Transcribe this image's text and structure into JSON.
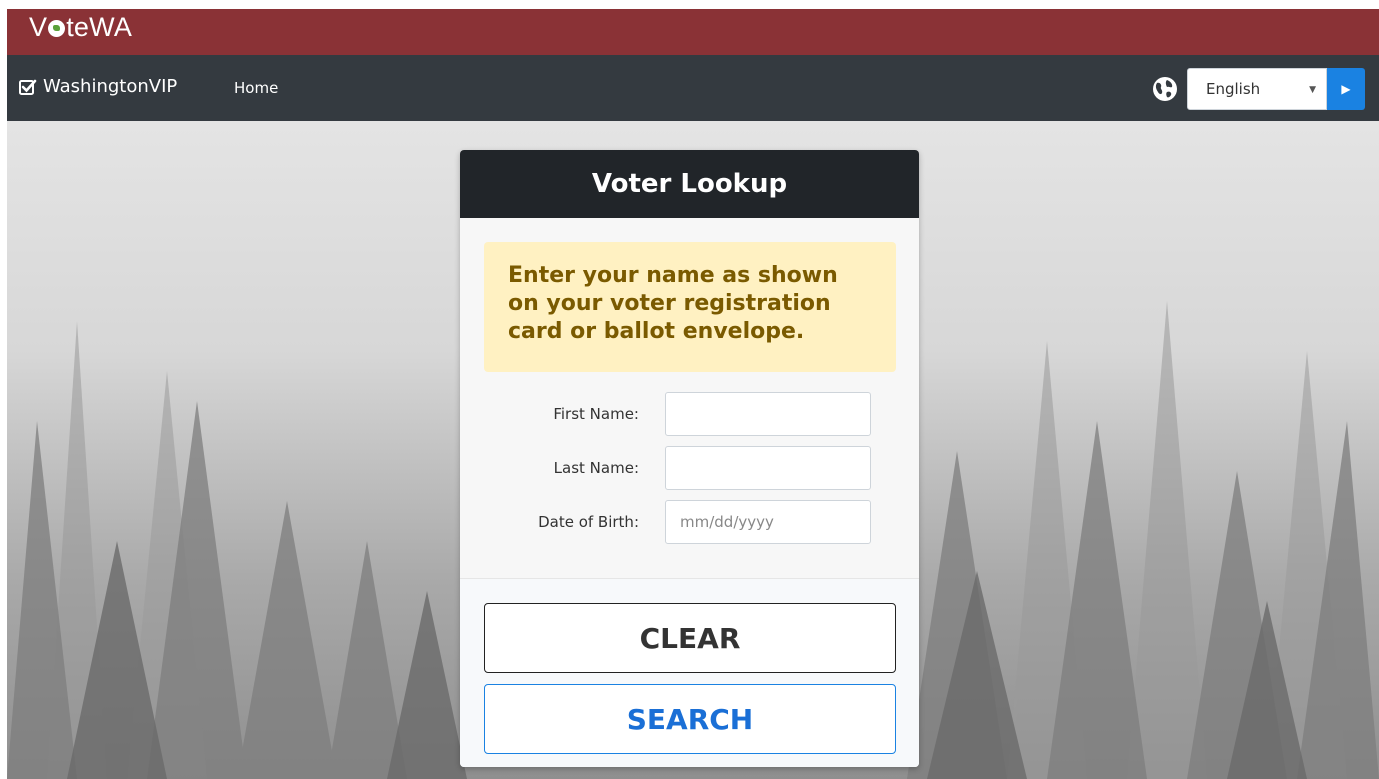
{
  "brand": {
    "prefix": "V",
    "suffix": "teWA"
  },
  "nav": {
    "brand_label": "WashingtonVIP",
    "home_label": "Home",
    "language_selected": "English"
  },
  "card": {
    "title": "Voter Lookup",
    "instructions": "Enter your name as shown on your voter registration card or ballot envelope.",
    "fields": {
      "first_name_label": "First Name:",
      "last_name_label": "Last Name:",
      "dob_label": "Date of Birth:",
      "dob_placeholder": "mm/dd/yyyy"
    },
    "buttons": {
      "clear": "CLEAR",
      "search": "SEARCH"
    }
  },
  "colors": {
    "brandbar": "#8a3236",
    "navbar": "#343a40",
    "accent": "#1a82e2",
    "alert_bg": "#fff1c2",
    "alert_text": "#7a5a00"
  }
}
